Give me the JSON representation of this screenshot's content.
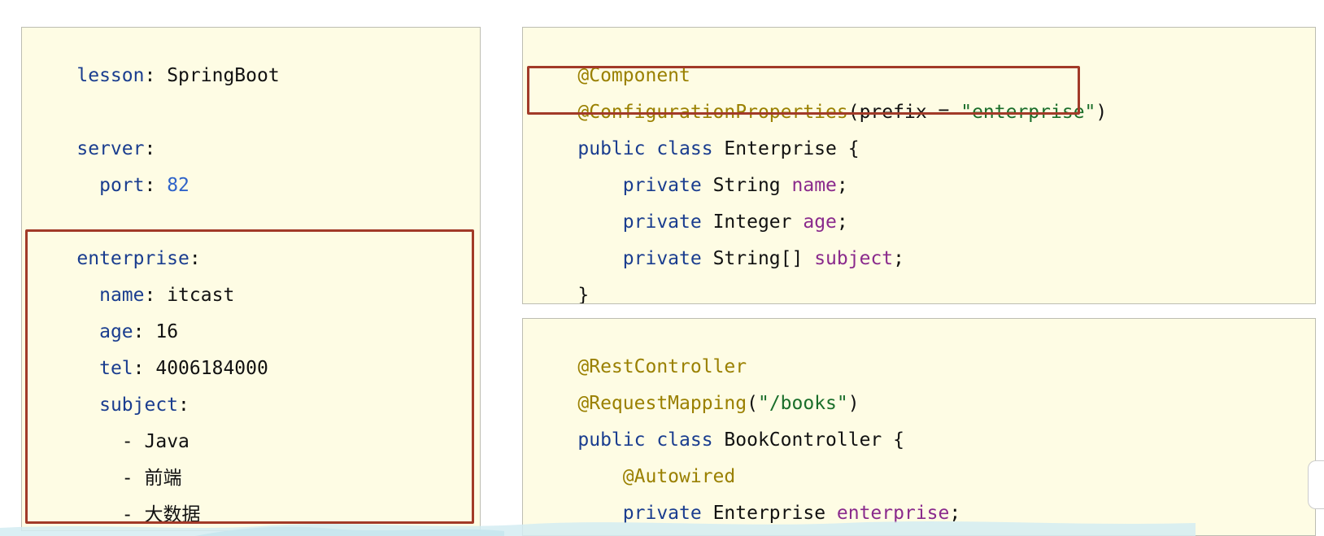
{
  "yaml": {
    "lesson_key": "lesson",
    "lesson_val": "SpringBoot",
    "server_key": "server",
    "port_key": "port",
    "port_val": "82",
    "enterprise_key": "enterprise",
    "name_key": "name",
    "name_val": "itcast",
    "age_key": "age",
    "age_val": "16",
    "tel_key": "tel",
    "tel_val": "4006184000",
    "subject_key": "subject",
    "subject_items": [
      "Java",
      "前端",
      "大数据"
    ],
    "colon": ":",
    "dash": "-"
  },
  "enterprise_class": {
    "component": "@Component",
    "config_props": "@ConfigurationProperties",
    "prefix_open": "(prefix = ",
    "prefix_value": "\"enterprise\"",
    "prefix_close": ")",
    "public_class": "public class",
    "class_name": " Enterprise {",
    "field1_kw": "private",
    "field1_type": " String ",
    "field1_name": "name",
    "field2_kw": "private",
    "field2_type": " Integer ",
    "field2_name": "age",
    "field3_kw": "private",
    "field3_type": " String[] ",
    "field3_name": "subject",
    "semi": ";",
    "close_brace": "}"
  },
  "controller_class": {
    "rest_controller": "@RestController",
    "request_mapping": "@RequestMapping",
    "rm_open": "(",
    "rm_path": "\"/books\"",
    "rm_close": ")",
    "public_class": "public class",
    "class_name": " BookController {",
    "autowired": "@Autowired",
    "field_kw": "private",
    "field_type": " Enterprise ",
    "field_name": "enterprise",
    "semi": ";",
    "close_brace": "}"
  },
  "colors": {
    "code_background": "#fefce4",
    "highlight_border": "#a23a28",
    "annotation": "#9a8000",
    "keyword": "#1a3d8f",
    "string": "#1a6e2a",
    "field": "#8a2a8c"
  }
}
